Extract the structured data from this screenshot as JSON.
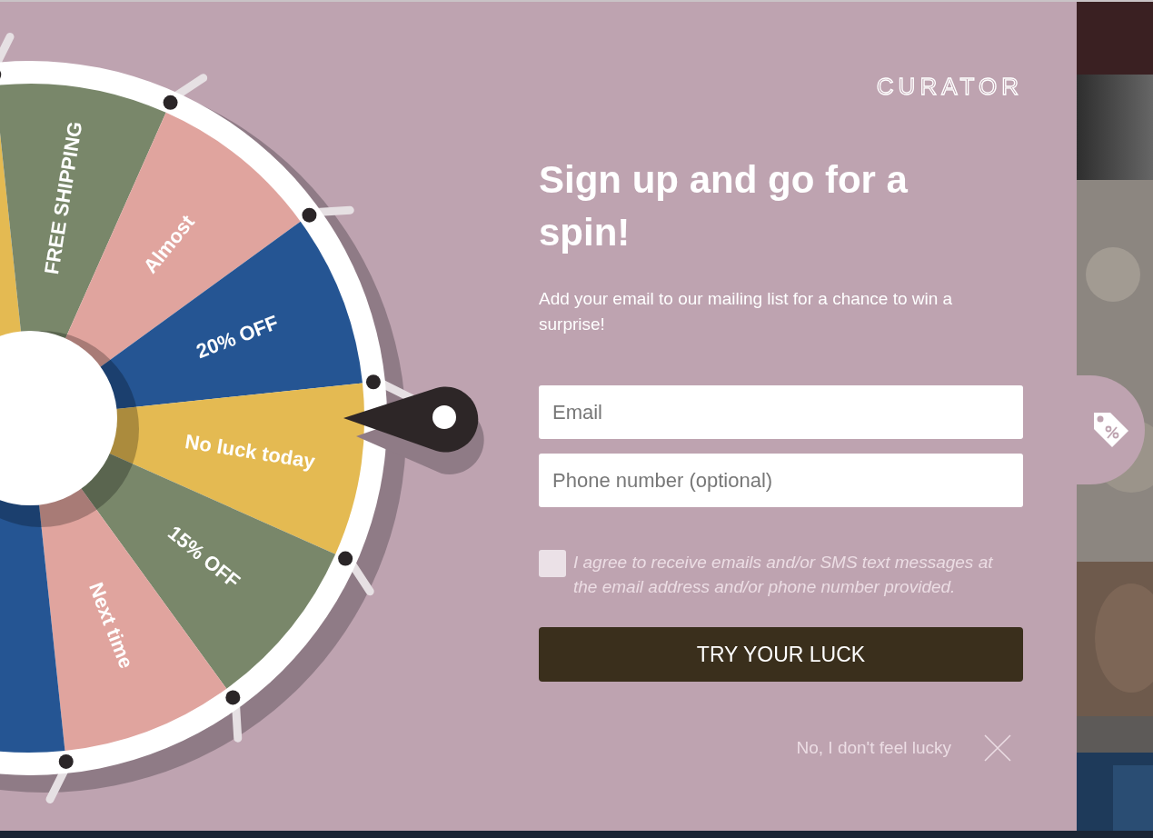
{
  "wheel": {
    "segments": [
      {
        "color": "#e4ba52"
      },
      {
        "label": "FREE SHIPPING",
        "color": "#79876a"
      },
      {
        "label": "Almost",
        "color": "#e0a49e"
      },
      {
        "label": "20% OFF",
        "color": "#255593"
      },
      {
        "label": "No luck today",
        "color": "#e4ba52"
      },
      {
        "label": "15% OFF",
        "color": "#79876a"
      },
      {
        "label": "Next time",
        "color": "#e0a49e"
      },
      {
        "color": "#255593"
      }
    ]
  },
  "logo": "CURATOR",
  "headline": "Sign up and go for a spin!",
  "subtitle": "Add your email to our mailing list for a chance to win a surprise!",
  "fields": [
    {
      "placeholder": "Email"
    },
    {
      "placeholder": "Phone number (optional)"
    }
  ],
  "consent": {
    "checked": false,
    "text": "I agree to receive emails and/or SMS text messages at the email address and/or phone number provided."
  },
  "submit": "TRY YOUR LUCK",
  "decline": "No, I don't feel lucky"
}
